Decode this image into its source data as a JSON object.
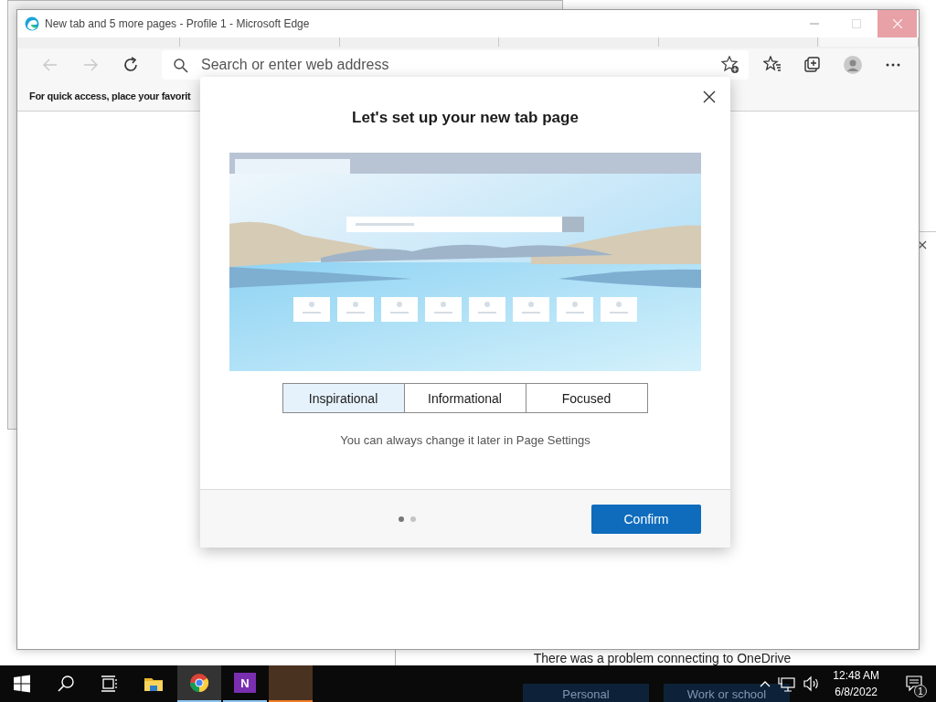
{
  "onedrive_window": {
    "message": "There was a problem connecting to OneDrive",
    "buttons": [
      "Personal",
      "Work or school"
    ]
  },
  "browser": {
    "title": "New tab and 5 more pages - Profile 1 - Microsoft Edge",
    "address_bar": {
      "placeholder": "Search or enter web address"
    },
    "favorites_bar_hint": "For quick access, place your favorit"
  },
  "dialog": {
    "title": "Let's set up your new tab page",
    "layouts": [
      {
        "label": "Inspirational",
        "selected": true
      },
      {
        "label": "Informational",
        "selected": false
      },
      {
        "label": "Focused",
        "selected": false
      }
    ],
    "hint": "You can always change it later in Page Settings",
    "steps": [
      {
        "selected": true
      },
      {
        "selected": false
      }
    ],
    "confirm": "Confirm"
  },
  "taskbar": {
    "apps": [
      {
        "kind": "explorer",
        "selected": false,
        "running": false
      },
      {
        "kind": "chrome",
        "selected": true,
        "running": true
      },
      {
        "kind": "onenote",
        "label": "N",
        "selected": false,
        "running": true
      },
      {
        "kind": "blank",
        "selected": false,
        "running": true
      }
    ],
    "time": "12:48 AM",
    "date": "6/8/2022",
    "notification_count": "1"
  }
}
